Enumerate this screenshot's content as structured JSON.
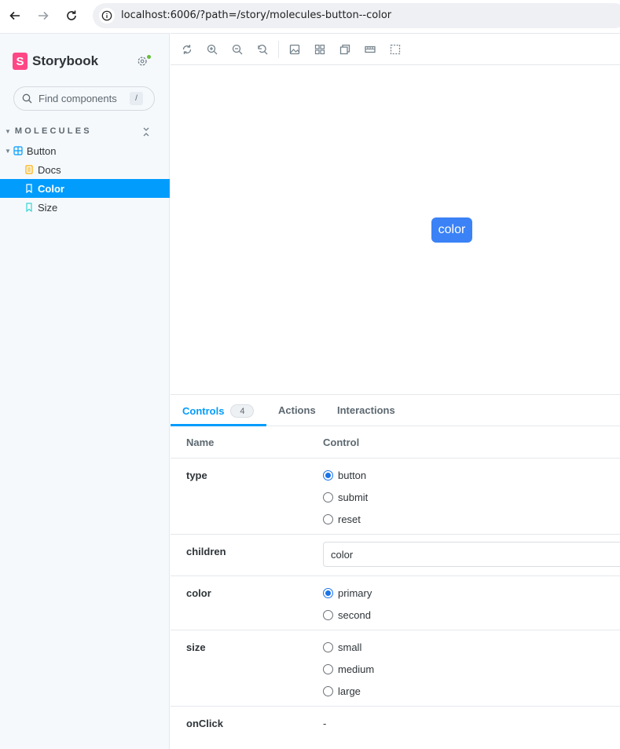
{
  "browser": {
    "url": "localhost:6006/?path=/story/molecules-button--color"
  },
  "sidebar": {
    "brand": "Storybook",
    "logo_letter": "S",
    "search_placeholder": "Find components",
    "search_shortcut": "/",
    "group_label": "MOLECULES",
    "items": [
      {
        "label": "Button",
        "icon": "component-icon",
        "level": 0,
        "selected": false
      },
      {
        "label": "Docs",
        "icon": "document-icon",
        "level": 1,
        "selected": false
      },
      {
        "label": "Color",
        "icon": "bookmark-icon",
        "level": 1,
        "selected": true
      },
      {
        "label": "Size",
        "icon": "bookmark-icon",
        "level": 1,
        "selected": false
      }
    ]
  },
  "canvas": {
    "button_label": "color",
    "button_color": "#3b82f6"
  },
  "panel": {
    "tabs": [
      {
        "label": "Controls",
        "count": "4",
        "active": true
      },
      {
        "label": "Actions",
        "active": false
      },
      {
        "label": "Interactions",
        "active": false
      }
    ],
    "headers": {
      "name": "Name",
      "control": "Control"
    },
    "controls": {
      "type": {
        "label": "type",
        "options": [
          "button",
          "submit",
          "reset"
        ],
        "selected": "button"
      },
      "children": {
        "label": "children",
        "value": "color"
      },
      "color": {
        "label": "color",
        "options": [
          "primary",
          "second"
        ],
        "selected": "primary"
      },
      "size": {
        "label": "size",
        "options": [
          "small",
          "medium",
          "large"
        ],
        "selected": null
      },
      "onClick": {
        "label": "onClick",
        "value": "-"
      }
    }
  },
  "colors": {
    "accent": "#029cfd",
    "brand": "#ff4785"
  }
}
